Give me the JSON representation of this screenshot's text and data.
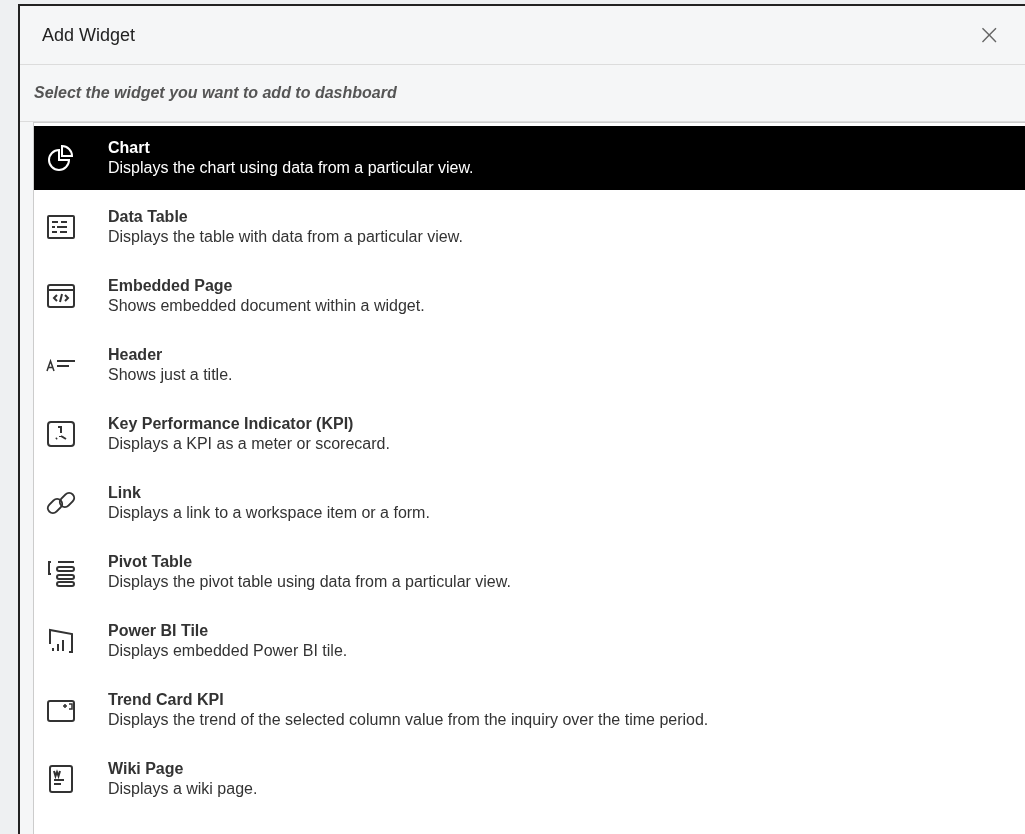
{
  "dialog": {
    "title": "Add Widget",
    "close": "×",
    "instruction": "Select the widget you want to add to dashboard"
  },
  "widgets": [
    {
      "name": "Chart",
      "description": "Displays the chart using data from a particular view.",
      "selected": true
    },
    {
      "name": "Data Table",
      "description": "Displays the table with data from a particular view.",
      "selected": false
    },
    {
      "name": "Embedded Page",
      "description": "Shows embedded document within a widget.",
      "selected": false
    },
    {
      "name": "Header",
      "description": "Shows just a title.",
      "selected": false
    },
    {
      "name": "Key Performance Indicator (KPI)",
      "description": "Displays a KPI as a meter or scorecard.",
      "selected": false
    },
    {
      "name": "Link",
      "description": "Displays a link to a workspace item or a form.",
      "selected": false
    },
    {
      "name": "Pivot Table",
      "description": "Displays the pivot table using data from a particular view.",
      "selected": false
    },
    {
      "name": "Power BI Tile",
      "description": "Displays embedded Power BI tile.",
      "selected": false
    },
    {
      "name": "Trend Card KPI",
      "description": "Displays the trend of the selected column value from the inquiry over the time period.",
      "selected": false
    },
    {
      "name": "Wiki Page",
      "description": "Displays a wiki page.",
      "selected": false
    }
  ]
}
